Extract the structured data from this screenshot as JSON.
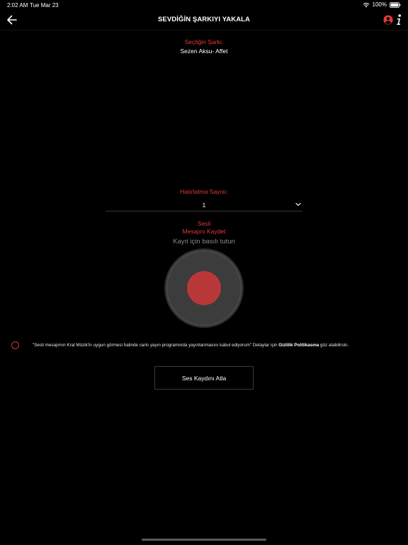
{
  "status_bar": {
    "time": "2:02 AM",
    "date": "Tue Mar 23",
    "battery": "100%"
  },
  "nav": {
    "title": "SEVDİĞİN ŞARKIYI YAKALA",
    "icons": [
      "back-arrow-icon",
      "user-profile-icon",
      "info-icon"
    ]
  },
  "song": {
    "label": "Seçtiğin Şarkı:",
    "name": "Sezen Aksu- Affet"
  },
  "reminder": {
    "label": "Hatırlatma Sayısı:",
    "selected": "1"
  },
  "record": {
    "title_line1": "Sesli",
    "title_line2": "Mesajını Kaydet",
    "hint": "Kayıt için basılı tutun"
  },
  "consent": {
    "text": "\"Sesli mesajımın Kral Müzik'in uygun görmesi halinde canlı yayın programında yayınlanmasını kabul ediyorum\" Detaylar için ",
    "link": "Gizlilik Politikasına",
    "suffix": " göz atabilirsin."
  },
  "skip": {
    "label": "Ses Kaydını Atla"
  },
  "colors": {
    "accent": "#e53939",
    "background": "#000000",
    "record_button": "#3c3c3c",
    "record_dot": "#b8383a"
  }
}
